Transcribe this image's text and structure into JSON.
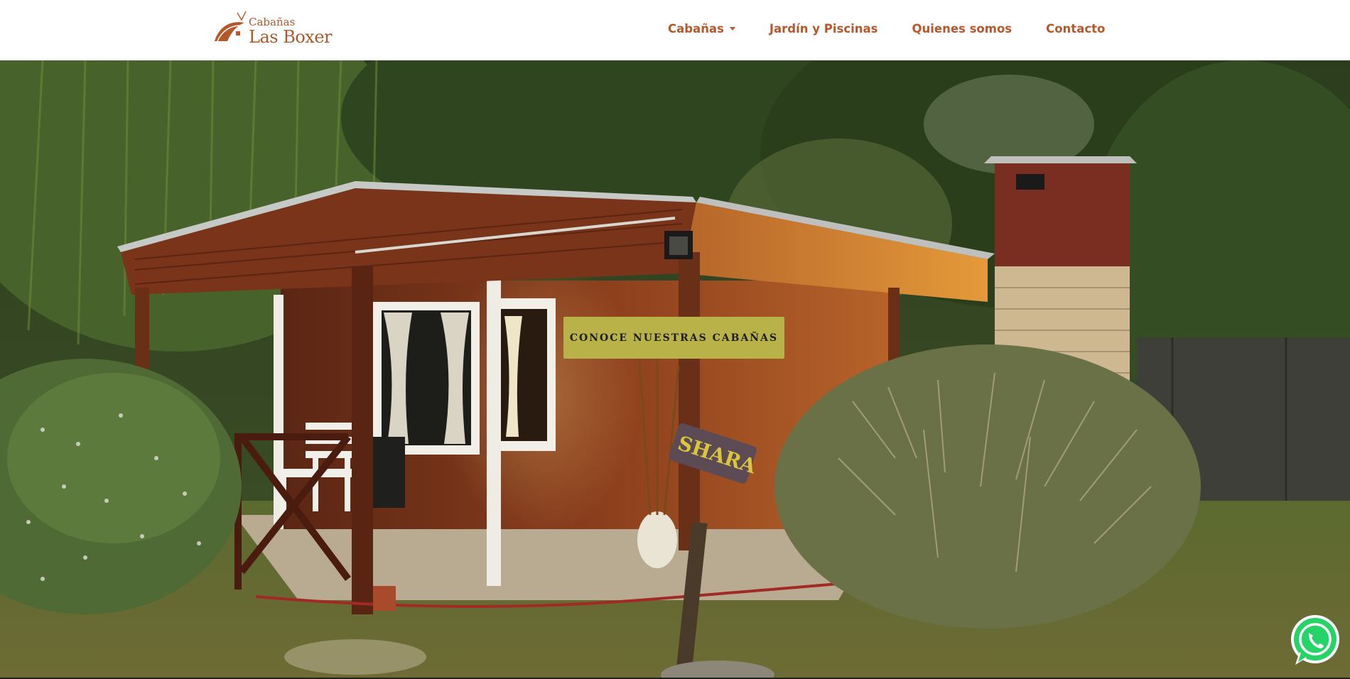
{
  "brand": {
    "top_text": "Cabañas",
    "main_text": "Las Boxer",
    "color": "#a85a2e"
  },
  "nav": {
    "items": [
      {
        "label": "Cabañas",
        "has_dropdown": true
      },
      {
        "label": "Jardín y Piscinas"
      },
      {
        "label": "Quienes somos"
      },
      {
        "label": "Contacto"
      }
    ],
    "color": "#b5582b"
  },
  "hero": {
    "cta_label": "CONOCE NUESTRAS CABAÑAS",
    "cta_color": "#b9b248",
    "sign_text": "SHARA"
  },
  "whatsapp": {
    "icon": "whatsapp-icon",
    "color": "#25d366"
  }
}
